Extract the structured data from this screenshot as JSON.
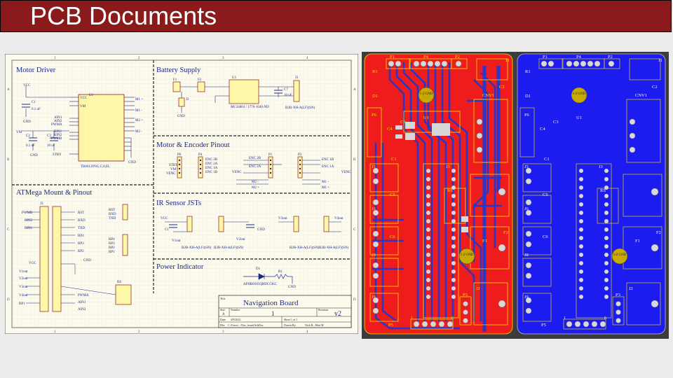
{
  "slide": {
    "title": "PCB Documents"
  },
  "schematic": {
    "sections": {
      "motor_driver": "Motor Driver",
      "battery_supply": "Battery Supply",
      "motor_encoder": "Motor & Encoder Pinout",
      "atmega": "ATMega Mount & Pinout",
      "ir_sensor": "IR Sensor JSTs",
      "power_indicator": "Power Indicator"
    },
    "border_cols": [
      "1",
      "2",
      "3",
      "4"
    ],
    "border_rows": [
      "A",
      "B",
      "C",
      "D"
    ],
    "labels": {
      "u1": "U1",
      "u1_part": "TB6612FNG,C,8,EL",
      "c1": "C1",
      "c1_val": "0.1 uF",
      "c2": "C2",
      "c2_val": "0.1 uF",
      "c3": "C3",
      "c3_val": "10 uF",
      "vm": "VM",
      "vcc": "VCC",
      "gnd": "GND",
      "ain1": "AIN1",
      "ain2": "AIN2",
      "pwma": "PWMA",
      "bin1": "BIN1",
      "bin2": "BIN2",
      "pwmb": "PWMB",
      "stby": "STBY",
      "m1p": "M1 +",
      "m1m": "M1 -",
      "m2p": "M2 +",
      "m2m": "M2 -",
      "f1": "F1",
      "f2": "F2",
      "j1": "J1",
      "j2": "J2",
      "reg": "MC34063 / 1776-1040-ND",
      "reg_part": "1776-1040-ND",
      "c7": "C7",
      "c7_val": "10 uF",
      "jst": "B2B-XH-A(LF)(SN)",
      "enc2b": "ENC 2B",
      "enc2a": "ENC 2A",
      "enc1a": "ENC 1A",
      "enc1b": "ENC 1B",
      "venc": "VENC",
      "p6": "P6",
      "p4": "P4",
      "p1": "P1",
      "p2": "P2",
      "p3": "P3",
      "rst": "RST",
      "rxd": "RXD",
      "txd": "TXD",
      "rp4": "RP4",
      "rp3": "RP3",
      "rp2": "RP2",
      "rp1": "RP1",
      "v1out": "V1out",
      "v2out": "V2out",
      "v3out": "V3out",
      "v4out": "V4out",
      "d1": "D1",
      "r1": "R1",
      "led": "APHB0305QBDCGKC",
      "rs": "RS",
      "j3": "J3"
    },
    "title_block": {
      "title_label": "Title",
      "title": "Navigation Board",
      "size_label": "Size",
      "size": "A",
      "number_label": "Number",
      "number": "1",
      "revision_label": "Revision",
      "revision": "v2",
      "date_label": "Date:",
      "date": "4/9/2022",
      "sheet": "Sheet 1 of 1",
      "file_label": "File:",
      "file": "C:\\Users\\...\\Nav_board.SchDoc",
      "drawn_label": "Drawn By:",
      "drawn_by": "Nick R., Matt M."
    }
  },
  "pcb_top": {
    "labels": {
      "p1": "P1",
      "p4": "P4",
      "p2": "P2",
      "j1": "J1",
      "r1": "R1",
      "d1": "D1",
      "c2": "C2",
      "cnv1": "CNV1",
      "u1": "U1",
      "p6": "P6",
      "c4": "C4",
      "c3": "C3",
      "c1": "C1",
      "j5": "J5",
      "j3": "J3",
      "c5": "C5",
      "rs": "RS",
      "j6": "J6",
      "f2": "F2",
      "c6": "C6",
      "f1": "F1",
      "j8": "J8",
      "j9": "J9",
      "j2": "J2",
      "p3": "P3",
      "p5": "P5",
      "gnd_mark": "1-2 GND",
      "pin1": "1",
      "pin6": "6"
    }
  },
  "pcb_bottom": {
    "labels": {
      "p1": "P1",
      "p4": "P4",
      "p2": "P2",
      "j1": "J1",
      "r1": "R1",
      "d1": "D1",
      "c2": "C2",
      "cnv1": "CNV1",
      "u1": "U1",
      "p6": "P6",
      "c4": "C4",
      "c3": "C3",
      "c1": "C1",
      "j5": "J5",
      "j3": "J3",
      "c5": "C5",
      "rs": "RS",
      "j6": "J6",
      "f2": "F2",
      "c6": "C6",
      "f1": "F1",
      "j8": "J8",
      "j9": "J9",
      "j2": "J2",
      "p3": "P3",
      "p5": "P5",
      "gnd_mark": "1-2 GND",
      "pin1": "1",
      "pin6": "6"
    }
  },
  "colors": {
    "title_bg": "#8b1a1a",
    "top_copper": "#ee1c1c",
    "top_trace": "#2936c8",
    "bottom_copper": "#1c1cf0",
    "silkscreen": "#f2e200",
    "sheet_bg": "#fdfaee",
    "section_title": "#1d2a86"
  }
}
